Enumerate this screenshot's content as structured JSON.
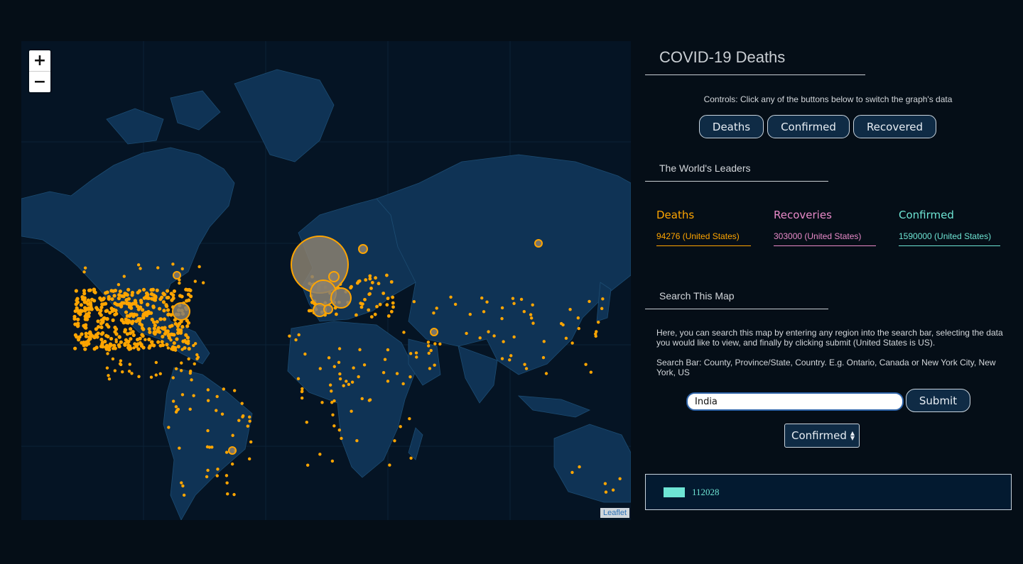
{
  "map": {
    "zoom_in": "+",
    "zoom_out": "−",
    "attribution": "Leaflet",
    "marker_color": "#ffa500"
  },
  "sidebar": {
    "title": "COVID-19 Deaths",
    "controls_text": "Controls: Click any of the buttons below to switch the graph's data",
    "buttons": [
      {
        "label": "Deaths"
      },
      {
        "label": "Confirmed"
      },
      {
        "label": "Recovered"
      }
    ],
    "leaders_title": "The World's Leaders",
    "leaders": [
      {
        "title": "Deaths",
        "value": "94276 (United States)",
        "color": "#ffa500"
      },
      {
        "title": "Recoveries",
        "value": "303000 (United States)",
        "color": "#e98ac9"
      },
      {
        "title": "Confirmed",
        "value": "1590000 (United States)",
        "color": "#6ee5d4"
      }
    ],
    "search_title": "Search This Map",
    "search_desc": "Here, you can search this map by entering any region into the search bar, selecting the data you would like to view, and finally by clicking submit (United States is US).",
    "search_format": "Search Bar: County, Province/State, Country. E.g. Ontario, Canada or New York City, New York, US",
    "search_value": "India",
    "submit_label": "Submit",
    "select_value": "Confirmed",
    "result": {
      "value": "112028",
      "color": "#6ee5d4"
    }
  }
}
